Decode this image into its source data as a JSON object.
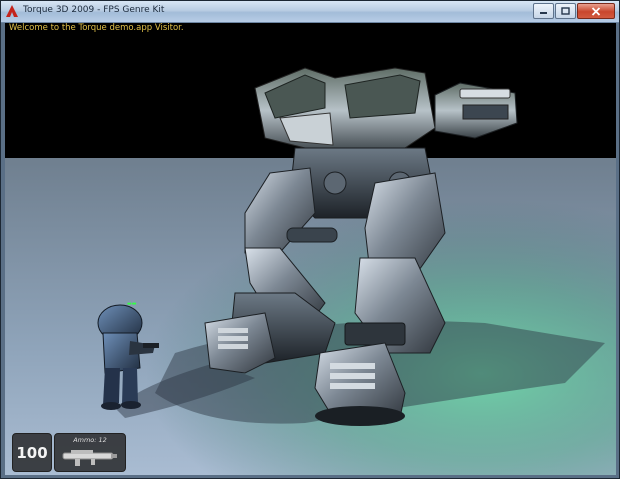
{
  "window": {
    "title": "Torque 3D 2009 - FPS Genre Kit",
    "icons": {
      "app": "torque-logo-icon",
      "minimize": "minimize-icon",
      "maximize": "maximize-icon",
      "close": "close-icon"
    }
  },
  "game": {
    "welcome_message": "Welcome to the Torque demo.app Visitor.",
    "hud": {
      "health": "100",
      "ammo_label": "Ammo: 12",
      "weapon_icon": "rocket-launcher-icon"
    }
  },
  "colors": {
    "welcome_text": "#e0c04a",
    "player_marker": "#33ff44",
    "hud_panel": "#323437"
  }
}
